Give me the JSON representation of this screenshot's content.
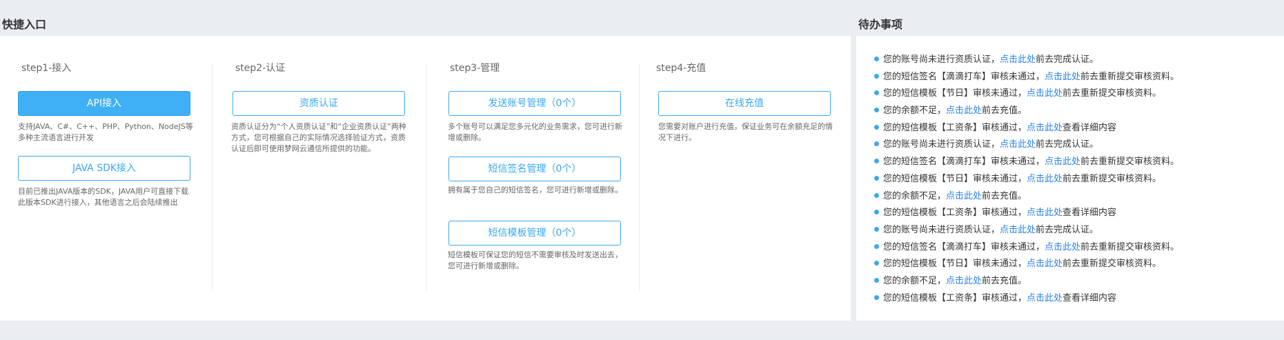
{
  "quick_entry": {
    "title": "快捷入口",
    "steps": [
      {
        "label": "step1-接入",
        "buttons": [
          {
            "label": "API接入",
            "desc": "支持JAVA、C#、C++、PHP、Python、NodeJS等多种主流语言进行开发"
          },
          {
            "label": "JAVA SDK接入",
            "desc": "目前已推出JAVA版本的SDK，JAVA用户可直接下载此版本SDK进行接入，其他语言之后会陆续推出"
          }
        ]
      },
      {
        "label": "step2-认证",
        "buttons": [
          {
            "label": "资质认证",
            "desc": "资质认证分为“个人资质认证”和“企业资质认证”两种方式，您可根据自己的实际情况选择验证方式，资质认证后即可使用梦网云通信所提供的功能。"
          }
        ]
      },
      {
        "label": "step3-管理",
        "buttons": [
          {
            "label": "发送账号管理（0个）",
            "desc": "多个账号可以满足您多元化的业务需求，您可进行新增或删除。"
          },
          {
            "label": "短信签名管理（0个）",
            "desc": "拥有属于您自己的短信签名，您可进行新增或删除。"
          },
          {
            "label": "短信模板管理（0个）",
            "desc": "短信模板可保证您的短信不需要审核及时发送出去，您可进行新增或删除。"
          }
        ]
      },
      {
        "label": "step4-充值",
        "buttons": [
          {
            "label": "在线充值",
            "desc": "您需要对账户进行充值，保证业务可在余额充足的情况下进行。"
          }
        ]
      }
    ]
  },
  "todo": {
    "title": "待办事项",
    "link_text": "点击此处",
    "items": [
      {
        "before": "您的账号尚未进行资质认证，",
        "after": "前去完成认证。"
      },
      {
        "before": "您的短信签名【滴滴打车】审核未通过，",
        "after": "前去重新提交审核资料。"
      },
      {
        "before": "您的短信模板【节日】审核未通过，",
        "after": "前去重新提交审核资料。"
      },
      {
        "before": "您的余额不足，",
        "after": "前去充值。"
      },
      {
        "before": "您的短信模板【工资条】审核通过，",
        "after": "查看详细内容"
      },
      {
        "before": "您的账号尚未进行资质认证，",
        "after": "前去完成认证。"
      },
      {
        "before": "您的短信签名【滴滴打车】审核未通过，",
        "after": "前去重新提交审核资料。"
      },
      {
        "before": "您的短信模板【节日】审核未通过，",
        "after": "前去重新提交审核资料。"
      },
      {
        "before": "您的余额不足，",
        "after": "前去充值。"
      },
      {
        "before": "您的短信模板【工资条】审核通过，",
        "after": "查看详细内容"
      },
      {
        "before": "您的账号尚未进行资质认证，",
        "after": "前去完成认证。"
      },
      {
        "before": "您的短信签名【滴滴打车】审核未通过，",
        "after": "前去重新提交审核资料。"
      },
      {
        "before": "您的短信模板【节日】审核未通过，",
        "after": "前去重新提交审核资料。"
      },
      {
        "before": "您的余额不足，",
        "after": "前去充值。"
      },
      {
        "before": "您的短信模板【工资条】审核通过，",
        "after": "查看详细内容"
      }
    ]
  },
  "colors": {
    "accent": "#3aa8f0",
    "link": "#2a82e4",
    "page_bg": "#eaedf2"
  }
}
